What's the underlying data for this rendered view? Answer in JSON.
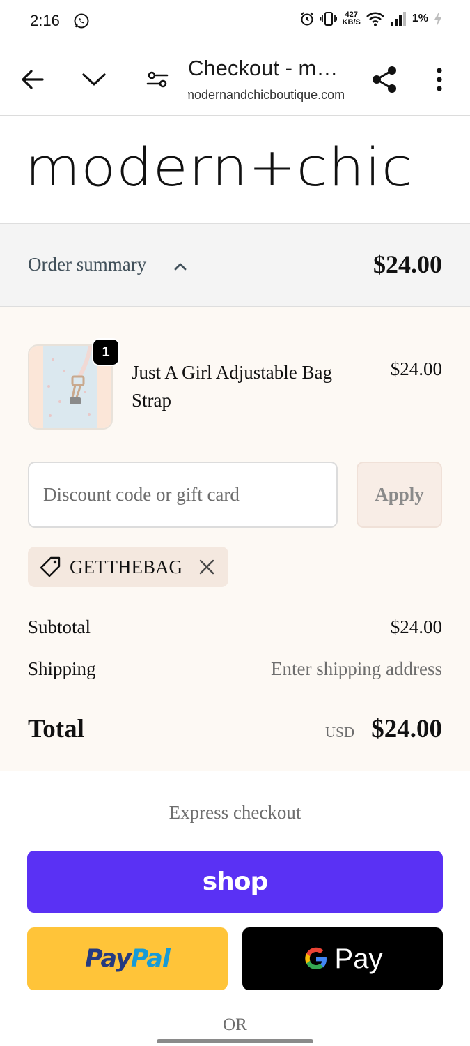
{
  "status_bar": {
    "time": "2:16",
    "net_speed_value": "427",
    "net_speed_unit": "KB/S",
    "battery": "1%"
  },
  "browser": {
    "title": "Checkout - m…",
    "url": "modernandchicboutique.com"
  },
  "store": {
    "logo_text": "modern+chic"
  },
  "order_summary": {
    "label": "Order summary",
    "total": "$24.00"
  },
  "cart": {
    "items": [
      {
        "name": "Just A Girl Adjustable Bag Strap",
        "price": "$24.00",
        "quantity": "1"
      }
    ]
  },
  "discount": {
    "placeholder": "Discount code or gift card",
    "value": "",
    "apply_label": "Apply",
    "applied_code": "GETTHEBAG"
  },
  "totals": {
    "subtotal_label": "Subtotal",
    "subtotal_value": "$24.00",
    "shipping_label": "Shipping",
    "shipping_value": "Enter shipping address",
    "total_label": "Total",
    "currency": "USD",
    "total_value": "$24.00"
  },
  "express": {
    "label": "Express checkout",
    "shop_label": "shop",
    "paypal_part1": "Pay",
    "paypal_part2": "Pal",
    "gpay_label": "Pay",
    "or_label": "OR"
  },
  "colors": {
    "shop_purple": "#5a31f4",
    "paypal_yellow": "#ffc439",
    "paypal_dark_blue": "#253b80",
    "paypal_light_blue": "#179bd7",
    "details_background": "#fdf9f4"
  }
}
